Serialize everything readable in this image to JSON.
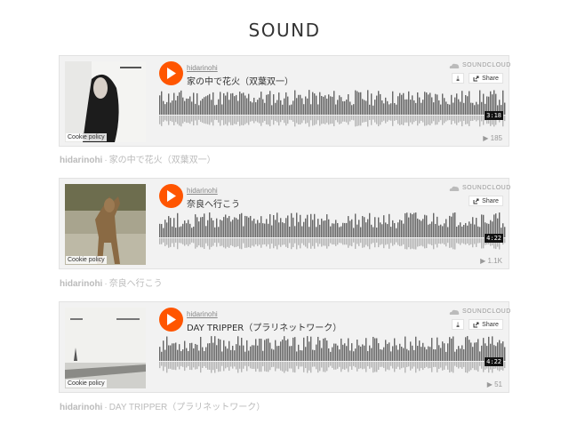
{
  "page": {
    "title": "SOUND"
  },
  "brand": {
    "accent": "#ff5500",
    "wave_color": "#666666"
  },
  "common": {
    "cookie_policy": "Cookie policy",
    "soundcloud_label": "SOUNDCLOUD",
    "share_label": "Share",
    "caption_separator": "·"
  },
  "tracks": [
    {
      "uploader": "hidarinohi",
      "title": "家の中で花火（双葉双一）",
      "duration": "3:18",
      "plays": "185",
      "caption_title": "家の中で花火（双葉双一）",
      "has_download": true
    },
    {
      "uploader": "hidarinohi",
      "title": "奈良へ行こう",
      "duration": "4:22",
      "plays": "1.1K",
      "caption_title": "奈良へ行こう",
      "has_download": false
    },
    {
      "uploader": "hidarinohi",
      "title": "DAY TRIPPER（プラリネットワーク）",
      "duration": "4:22",
      "plays": "51",
      "caption_title": "DAY TRIPPER（プラリネットワーク）",
      "has_download": true
    }
  ]
}
